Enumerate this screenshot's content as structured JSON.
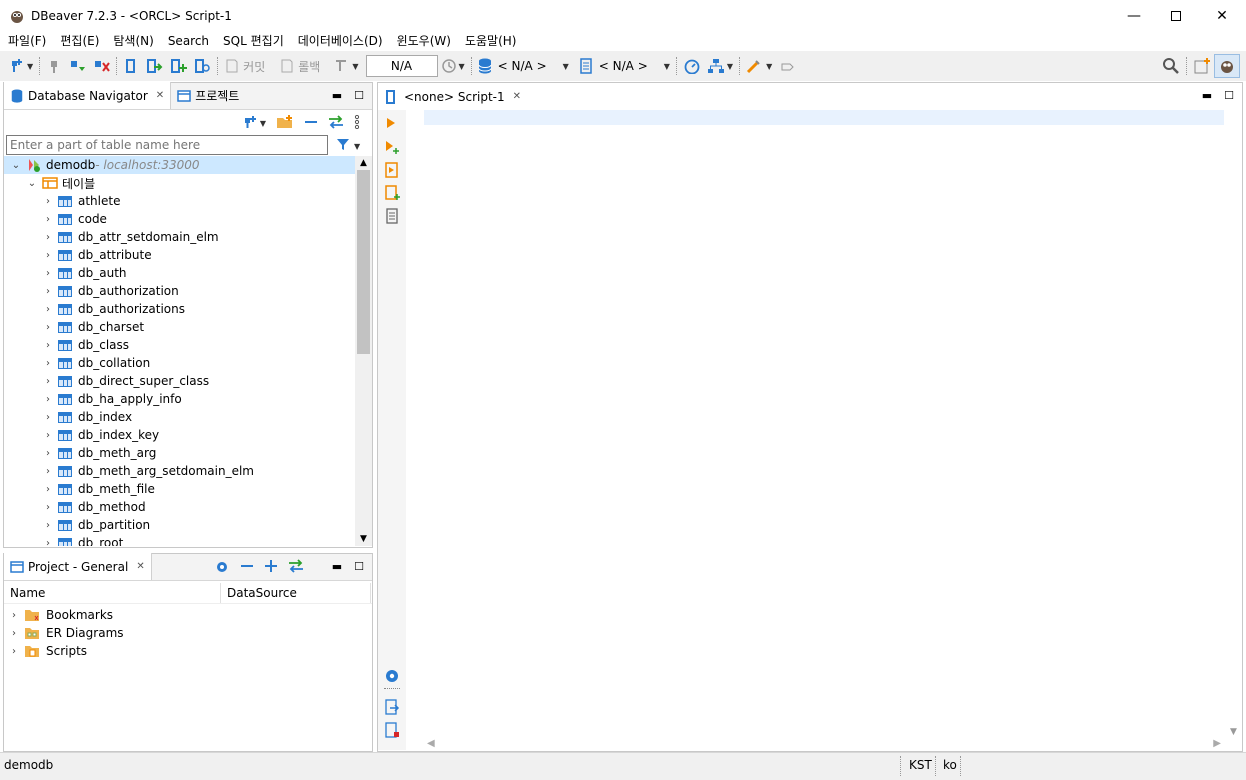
{
  "window": {
    "title": "DBeaver 7.2.3 - <ORCL> Script-1",
    "minimize_icon": "minimize-icon",
    "maximize_icon": "maximize-icon",
    "close_icon": "close-icon"
  },
  "menu": [
    "파일(F)",
    "편집(E)",
    "탐색(N)",
    "Search",
    "SQL 편집기",
    "데이터베이스(D)",
    "윈도우(W)",
    "도움말(H)"
  ],
  "toolbar": {
    "commit_label": "커밋",
    "rollback_label": "롤백",
    "transaction_mode_value": "N/A",
    "datasource_selector": "< N/A >",
    "schema_selector": "< N/A >"
  },
  "navigator": {
    "tab_label": "Database Navigator",
    "project_tab_label": "프로젝트",
    "filter_placeholder": "Enter a part of table name here",
    "connection_name": "demodb",
    "connection_host": " - localhost:33000",
    "tables_folder": "테이블",
    "tables": [
      "athlete",
      "code",
      "db_attr_setdomain_elm",
      "db_attribute",
      "db_auth",
      "db_authorization",
      "db_authorizations",
      "db_charset",
      "db_class",
      "db_collation",
      "db_direct_super_class",
      "db_ha_apply_info",
      "db_index",
      "db_index_key",
      "db_meth_arg",
      "db_meth_arg_setdomain_elm",
      "db_meth_file",
      "db_method",
      "db_partition",
      "db_root"
    ]
  },
  "project": {
    "tab_label": "Project - General",
    "columns": [
      "Name",
      "DataSource"
    ],
    "items": [
      "Bookmarks",
      "ER Diagrams",
      "Scripts"
    ]
  },
  "editor": {
    "tab_label": "<none> Script-1"
  },
  "status": {
    "connection": "demodb",
    "timezone": "KST",
    "locale": "ko"
  },
  "colors": {
    "accent_blue": "#2a7bd0",
    "run_orange": "#f08a00",
    "selection": "#cde8ff",
    "current_line": "#e8f2fe"
  }
}
